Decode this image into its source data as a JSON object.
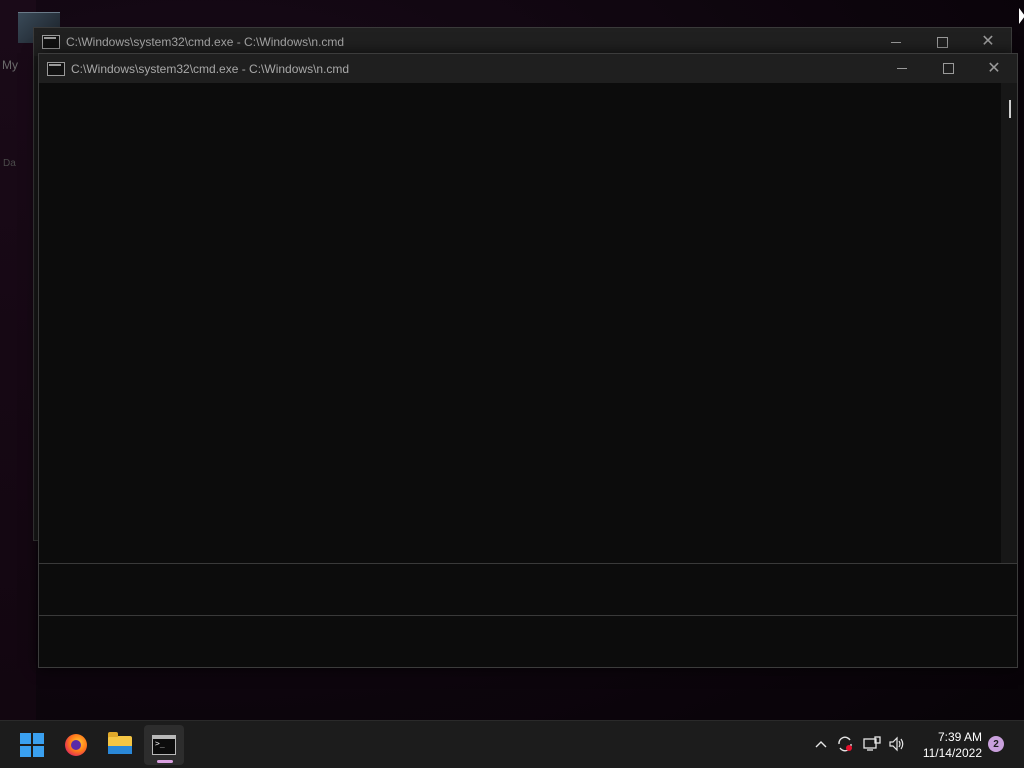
{
  "desktop": {
    "label_1": "My",
    "label_2": "Da"
  },
  "windows": {
    "back": {
      "title": "C:\\Windows\\system32\\cmd.exe - C:\\Windows\\n.cmd",
      "icon": "cmd-icon"
    },
    "front": {
      "title": "C:\\Windows\\system32\\cmd.exe - C:\\Windows\\n.cmd",
      "icon": "cmd-icon",
      "background": "#0c0c0c"
    },
    "controls": {
      "minimize_icon": "minimize-icon",
      "maximize_icon": "maximize-icon",
      "close_glyph": "✕"
    }
  },
  "taskbar": {
    "pinned": [
      {
        "name": "start",
        "icon": "windows-start-icon"
      },
      {
        "name": "firefox",
        "icon": "firefox-icon"
      },
      {
        "name": "file-explorer",
        "icon": "folder-icon"
      },
      {
        "name": "command-prompt",
        "icon": "cmd-icon",
        "active": true
      }
    ],
    "tray": {
      "overflow_glyph": "^",
      "icons": [
        "sync-icon",
        "network-icon",
        "volume-icon"
      ],
      "time": "7:39 AM",
      "date": "11/14/2022",
      "notification_count": "2"
    }
  },
  "colors": {
    "start_accent": "#3aa0f0",
    "active_indicator": "#d9a0e0",
    "notification_badge": "#c9a0dc",
    "titlebar_bg": "#202020",
    "console_bg": "#0c0c0c"
  }
}
